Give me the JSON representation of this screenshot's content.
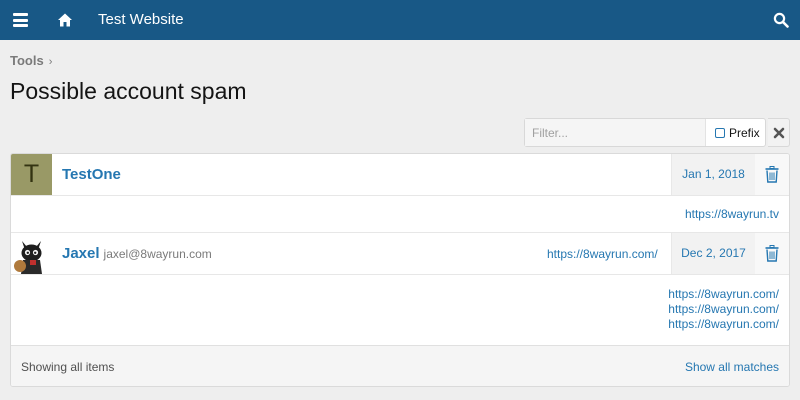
{
  "header": {
    "menu_icon": "hamburger-menu-icon",
    "home_icon": "home-icon",
    "site_title": "Test Website",
    "search_icon": "search-icon"
  },
  "breadcrumb": {
    "label": "Tools",
    "separator": "›"
  },
  "page": {
    "title": "Possible account spam"
  },
  "filter": {
    "placeholder": "Filter...",
    "value": "",
    "prefix_label": "Prefix",
    "prefix_checked": false,
    "clear_label": "✖"
  },
  "entries": [
    {
      "avatar_letter": "T",
      "avatar_color": "#999966",
      "username": "TestOne",
      "email": "",
      "head_url": "",
      "date": "Jan 1, 2018",
      "urls": [
        "https://8wayrun.tv"
      ]
    },
    {
      "avatar_letter": "",
      "avatar_color": "#ffffff",
      "username": "Jaxel",
      "email": "jaxel@8wayrun.com",
      "head_url": "https://8wayrun.com/",
      "date": "Dec 2, 2017",
      "urls": [
        "https://8wayrun.com/",
        "https://8wayrun.com/",
        "https://8wayrun.com/"
      ]
    }
  ],
  "footer": {
    "showing_label": "Showing all items",
    "show_all_label": "Show all matches"
  },
  "colors": {
    "header_bg": "#185886",
    "link": "#2577b1",
    "page_bg": "#eeeeee"
  }
}
